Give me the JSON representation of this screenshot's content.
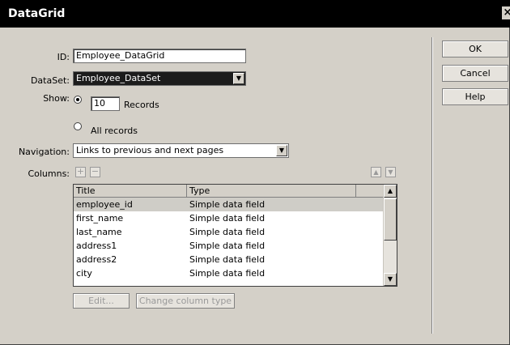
{
  "window": {
    "title": "DataGrid",
    "close_icon": "x-icon"
  },
  "form": {
    "id_label": "ID:",
    "id_value": "Employee_DataGrid",
    "dataset_label": "DataSet:",
    "dataset_value": "Employee_DataSet",
    "show_label": "Show:",
    "records_count": "10",
    "records_label": "Records",
    "all_records_label": "All records",
    "navigation_label": "Navigation:",
    "navigation_value": "Links to previous and next pages",
    "columns_label": "Columns:",
    "add_symbol": "+",
    "remove_symbol": "−",
    "up_symbol": "▲",
    "down_symbol": "▼"
  },
  "grid": {
    "headers": [
      "Title",
      "Type"
    ],
    "rows": [
      [
        "employee_id",
        "Simple data field"
      ],
      [
        "first_name",
        "Simple data field"
      ],
      [
        "last_name",
        "Simple data field"
      ],
      [
        "address1",
        "Simple data field"
      ],
      [
        "address2",
        "Simple data field"
      ],
      [
        "city",
        "Simple data field"
      ]
    ]
  },
  "actions": {
    "edit": "Edit...",
    "change_type": "Change column type"
  },
  "buttons": {
    "ok": "OK",
    "cancel": "Cancel",
    "help": "Help"
  }
}
